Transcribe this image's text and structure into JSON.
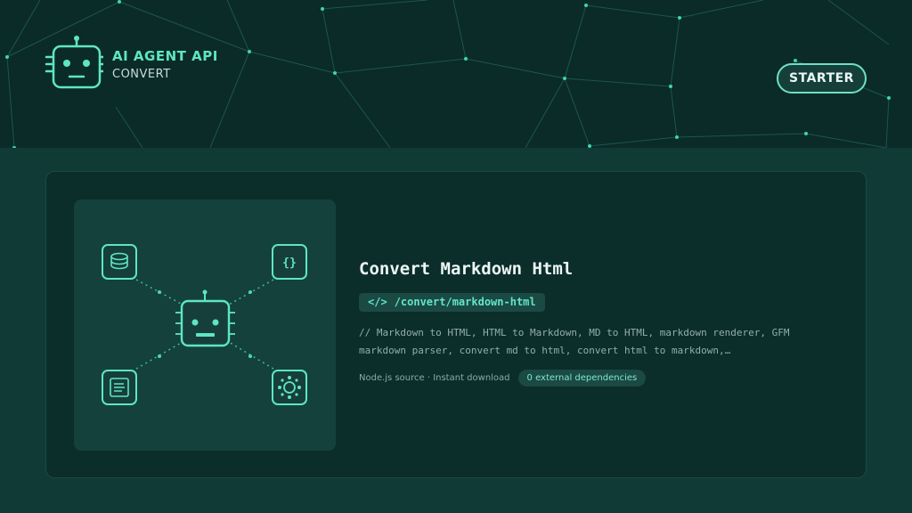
{
  "header": {
    "brand_title": "AI AGENT API",
    "brand_subtitle": "CONVERT",
    "starter_label": "STARTER"
  },
  "card": {
    "title": "Convert Markdown Html",
    "endpoint_icon": "</>",
    "endpoint": "/convert/markdown-html",
    "description": "// Markdown to HTML, HTML to Markdown, MD to HTML, markdown renderer, GFM markdown parser, convert md to html, convert html to markdown,…",
    "meta": "Node.js source · Instant download",
    "deps_badge": "0 external dependencies"
  },
  "illustration": {
    "nodes": [
      "database-icon",
      "braces-icon",
      "document-icon",
      "hub-icon"
    ],
    "center": "robot-icon"
  },
  "colors": {
    "accent": "#5ee6c4",
    "background": "#0f3a36",
    "header": "#0b2b28",
    "card": "#0b2e2b"
  }
}
